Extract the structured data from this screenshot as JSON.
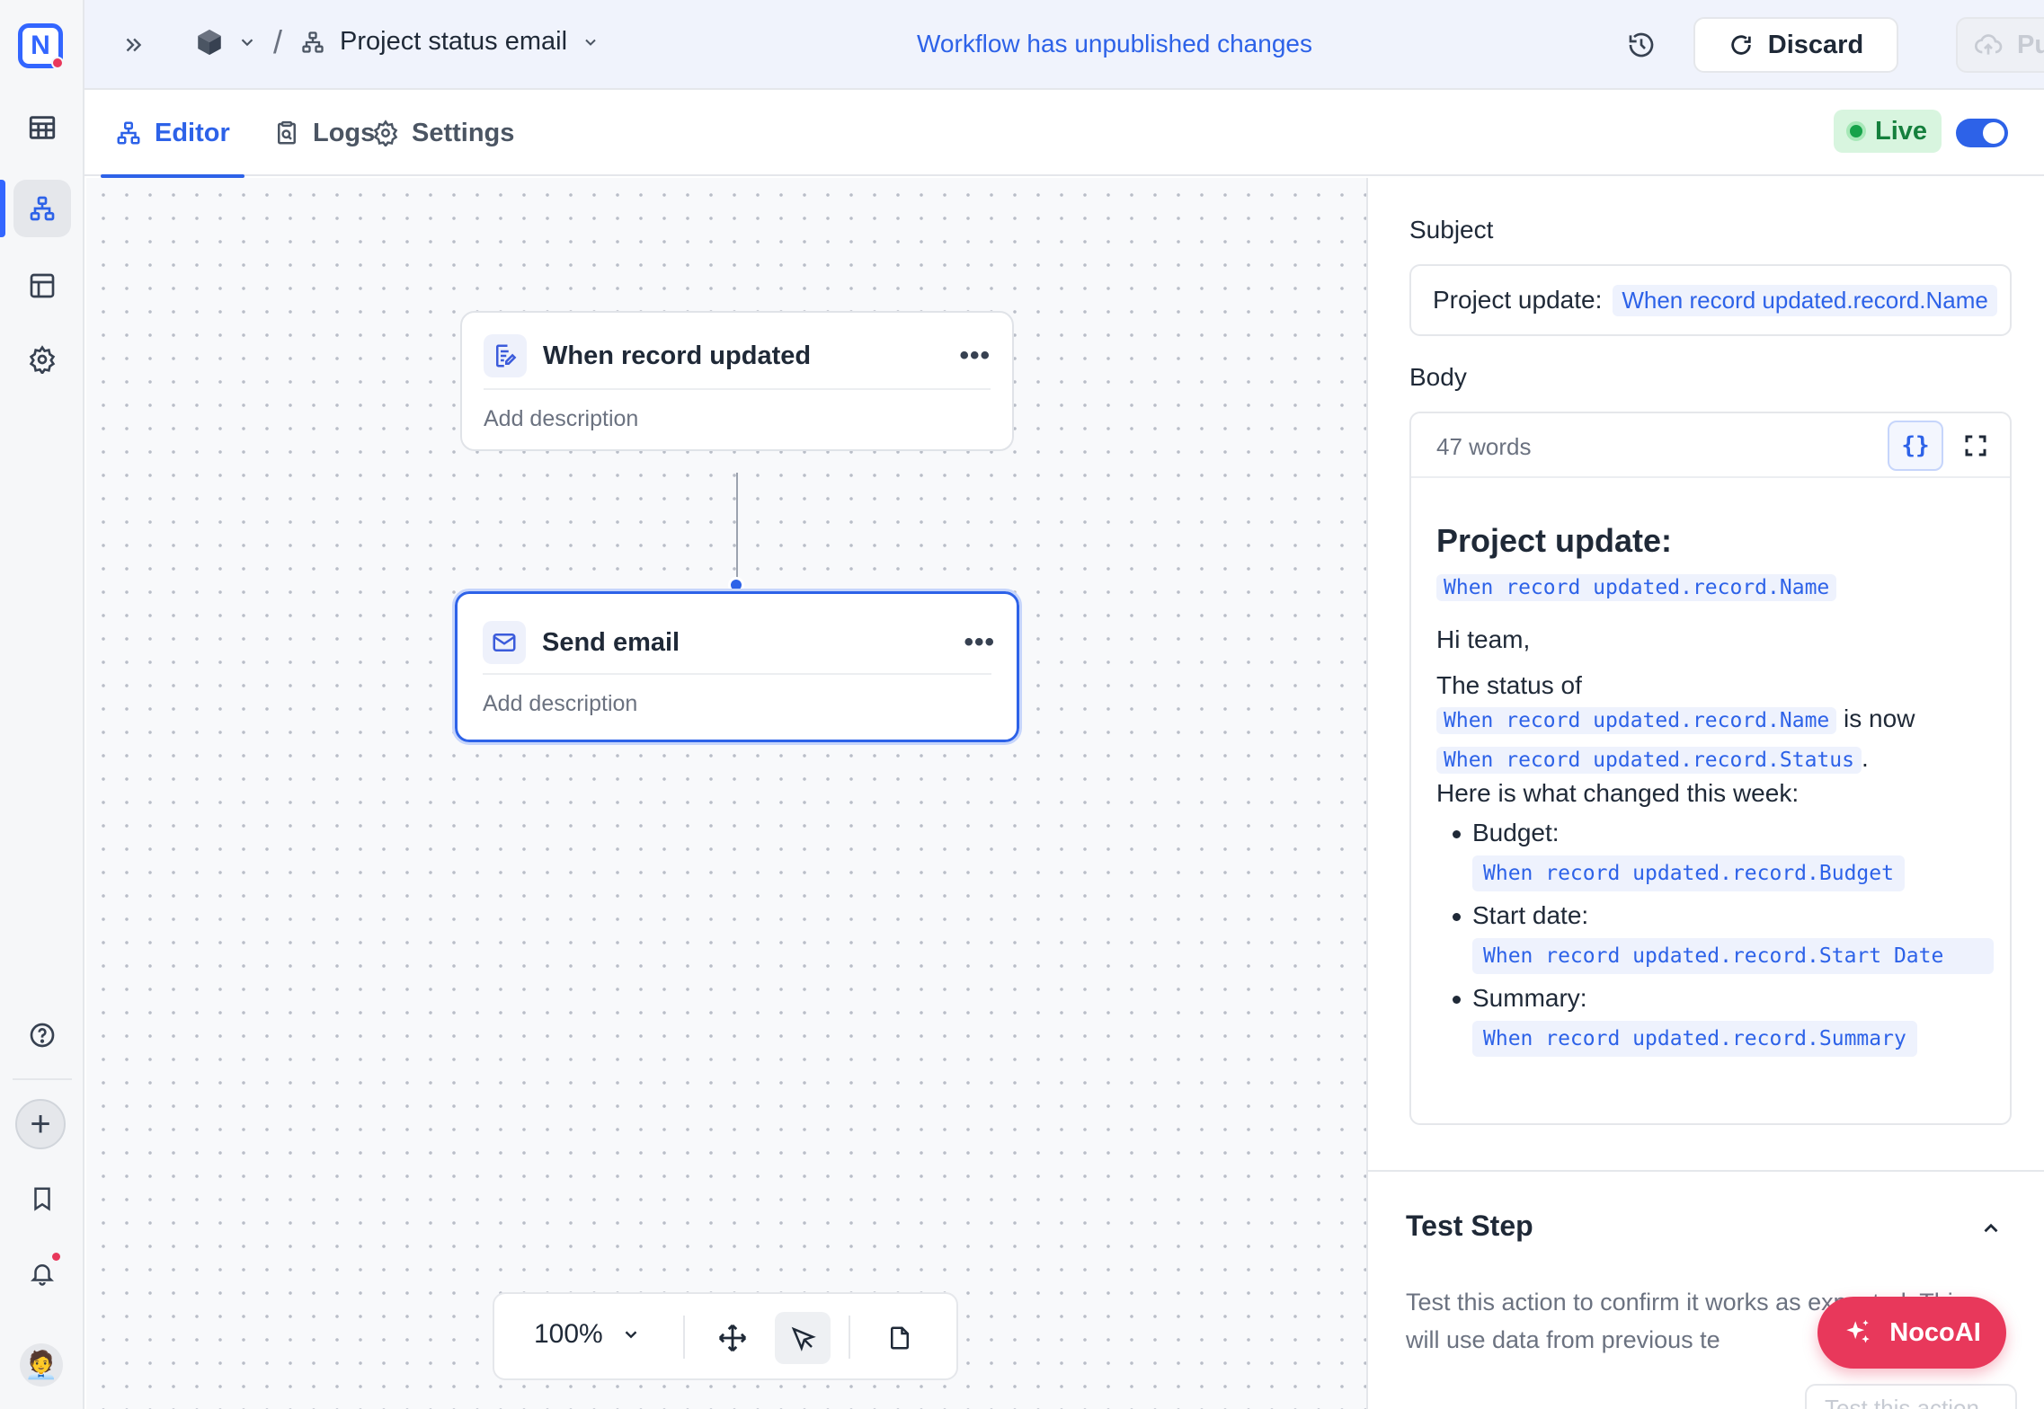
{
  "app": {
    "logo_letter": "N",
    "brand_color": "#3366ff",
    "accent": "#2d62e8"
  },
  "rail": {
    "items": [
      "table-icon",
      "workflow-icon",
      "dashboard-icon",
      "settings-icon",
      "help-icon",
      "plus-icon",
      "bookmark-icon",
      "bell-icon"
    ],
    "active_item": "workflow-icon"
  },
  "topbar": {
    "workflow_title": "Project status email",
    "unpublished_notice": "Workflow has unpublished changes",
    "discard_label": "Discard",
    "publish_label": "Publish"
  },
  "tabs": {
    "editor": "Editor",
    "logs": "Logs",
    "settings": "Settings",
    "active": "Editor"
  },
  "live": {
    "label": "Live",
    "enabled": true
  },
  "canvas": {
    "nodes": [
      {
        "title": "When record updated",
        "description": "Add description",
        "icon": "record-edit-icon",
        "selected": false
      },
      {
        "title": "Send email",
        "description": "Add description",
        "icon": "mail-icon",
        "selected": true
      }
    ],
    "more_glyph": "•••",
    "zoom": "100%"
  },
  "panel": {
    "subject_label": "Subject",
    "subject_prefix": "Project update:",
    "subject_variable": "When record updated.record.Name",
    "body_label": "Body",
    "word_count": "47 words",
    "braces_glyph": "{}",
    "body": {
      "heading": "Project update:",
      "heading_variable": "When record updated.record.Name",
      "greeting": "Hi team,",
      "status_of": "The status of",
      "status_name_variable": "When record updated.record.Name",
      "is_now": "is now",
      "status_variable": "When record updated.record.Status",
      "period": ".",
      "changed_intro": "Here is what changed this week:",
      "items": [
        {
          "label": "Budget:",
          "variable": "When record updated.record.Budget"
        },
        {
          "label": "Start date:",
          "variable": "When record updated.record.Start Date"
        },
        {
          "label": "Summary:",
          "variable": "When record updated.record.Summary"
        }
      ]
    },
    "test_step": {
      "title": "Test Step",
      "description": "Test this action to confirm it works as expected. This will use data from previous te",
      "button_label": "Test this action"
    }
  },
  "nocoai": {
    "label": "NocoAI"
  }
}
